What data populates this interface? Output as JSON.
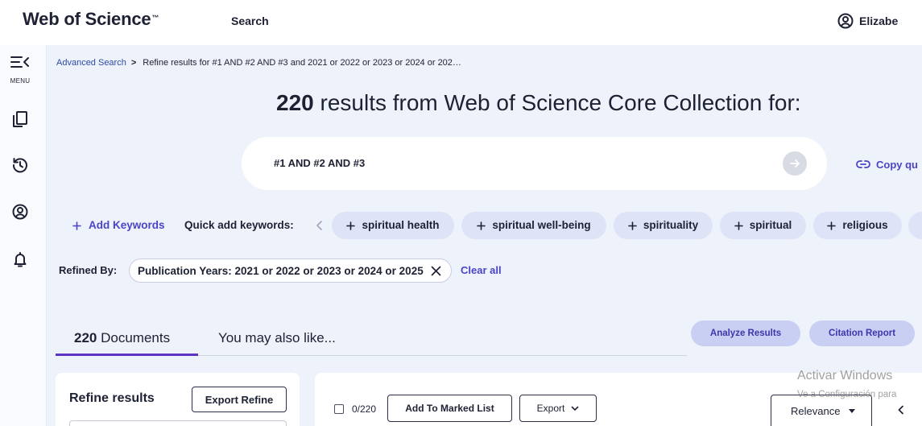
{
  "header": {
    "logo": "Web of Science",
    "logo_mark": "™",
    "nav_search": "Search",
    "user_name": "Elizabe",
    "user_icon": "account-circle-icon"
  },
  "sidebar": {
    "menu_label": "MENU",
    "icons": [
      "menu-collapse-icon",
      "marked-list-icon",
      "history-icon",
      "account-icon",
      "notifications-bell-icon"
    ]
  },
  "breadcrumb": {
    "link": "Advanced Search",
    "separator": ">",
    "current": "Refine results for #1 AND #2 AND #3 and 2021 or 2022 or 2023 or 2024 or 202…"
  },
  "results_heading": {
    "count": "220",
    "text": "results from Web of Science Core Collection for:"
  },
  "query": {
    "text": "#1 AND #2 AND #3",
    "submit_icon": "arrow-right-icon",
    "copy_link_label": "Copy qu",
    "copy_link_icon": "link-icon"
  },
  "keywords": {
    "add_label": "Add Keywords",
    "quick_add_label": "Quick add keywords:",
    "chips": [
      "spiritual health",
      "spiritual well-being",
      "spirituality",
      "spiritual",
      "religious"
    ]
  },
  "refined_by": {
    "label": "Refined By:",
    "filter": "Publication Years: 2021 or 2022 or 2023 or 2024 or 2025",
    "clear_all": "Clear all"
  },
  "tabs": {
    "documents_count": "220",
    "documents_label": "Documents",
    "also_like_label": "You may also like..."
  },
  "actions": {
    "analyze": "Analyze Results",
    "citation_report": "Citation Report"
  },
  "refine_panel": {
    "title": "Refine results",
    "export_button": "Export Refine"
  },
  "results_toolbar": {
    "selected_count": "0/220",
    "add_to_marked_list": "Add To Marked List",
    "export": "Export",
    "sort_value": "Relevance"
  },
  "watermark": {
    "title": "Activar Windows",
    "subtitle": "Ve a Configuración para"
  },
  "colors": {
    "accent": "#4b45c6",
    "link": "#2b4aa8",
    "page_bg": "#eef2fb",
    "chip_bg": "#dfe3f7",
    "button_bg": "#c9cef3",
    "button_text": "#3c37ae",
    "tab_underline": "#5e33bf",
    "text": "#1d2133"
  }
}
